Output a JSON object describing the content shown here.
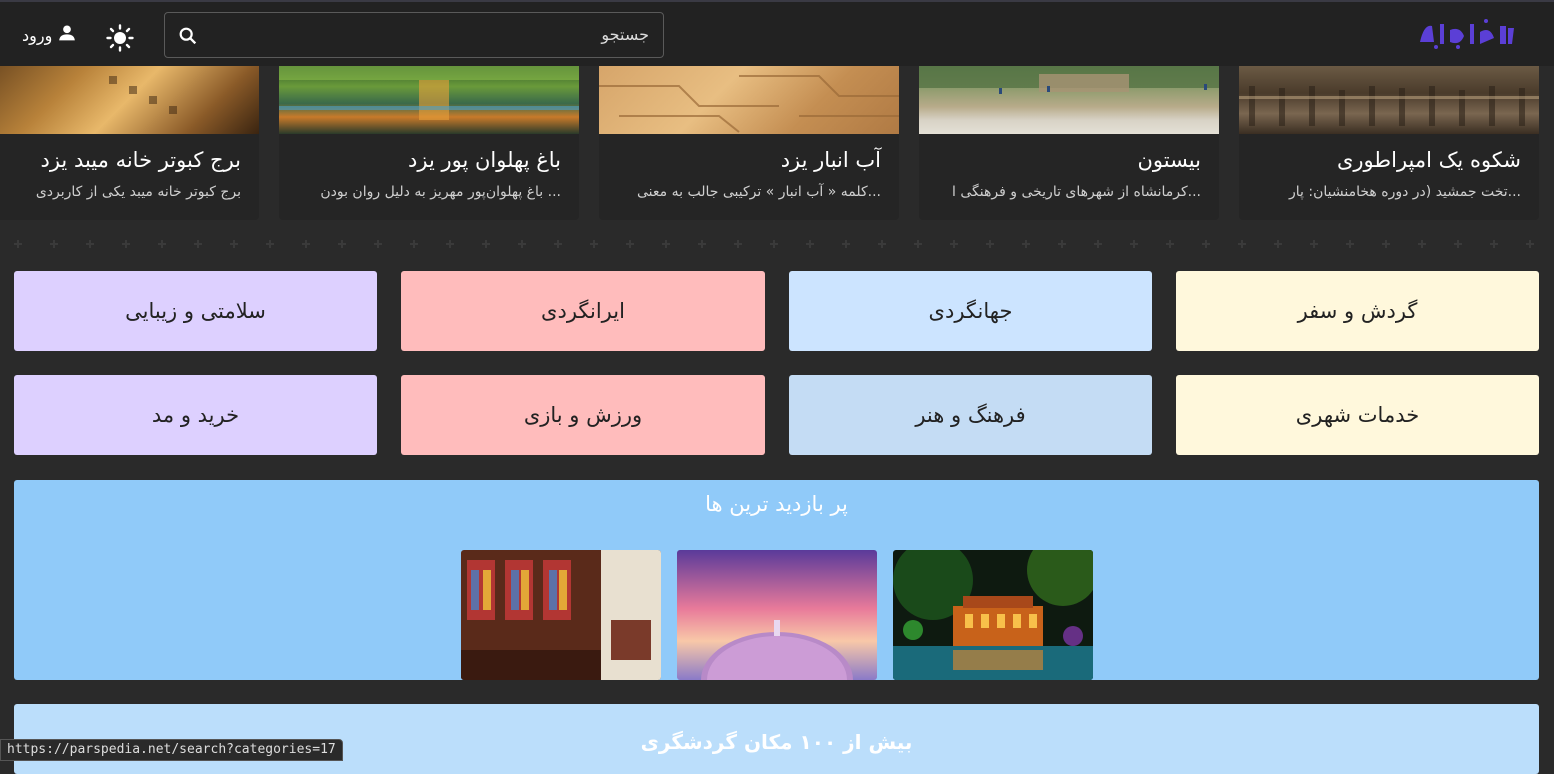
{
  "header": {
    "logo_text": "پارس‌پدیا",
    "search_placeholder": "جستجو",
    "login_label": "ورود",
    "icons": [
      "search-icon",
      "sun-icon",
      "person-icon"
    ]
  },
  "carousel": [
    {
      "title": "شکوه یک امپراطوری",
      "desc": "تخت جمشید (در دوره هخامنشیان: پار..."
    },
    {
      "title": "بیستون",
      "desc": "کرمانشاه از شهرهای تاریخی و فرهنگی ا..."
    },
    {
      "title": "آب انبار یزد",
      "desc": "کلمه « آب انبار » ترکیبی جالب به معنی..."
    },
    {
      "title": "باغ پهلوان پور یزد",
      "desc": "باغ پهلوان‌پور مهریز به دلیل روان بودن ..."
    },
    {
      "title": "برج کبوتر خانه میبد یزد",
      "desc": "برج کبوتر خانه میبد یکی از کاربردی‌"
    }
  ],
  "categories": [
    {
      "label": "گردش و سفر",
      "color": "#fff8dc"
    },
    {
      "label": "جهانگردی",
      "color": "#cce4ff"
    },
    {
      "label": "ایرانگردی",
      "color": "#ffbcbc"
    },
    {
      "label": "سلامتی و زیبایی",
      "color": "#ddd0ff"
    },
    {
      "label": "خدمات شهری",
      "color": "#fff8dc"
    },
    {
      "label": "فرهنگ و هنر",
      "color": "#c4dcf4"
    },
    {
      "label": "ورزش و بازی",
      "color": "#ffbcbc"
    },
    {
      "label": "خرید و مد",
      "color": "#ddd0ff"
    }
  ],
  "popular": {
    "title": "پر بازدید ترین ها"
  },
  "more": {
    "title": "بیش از ۱۰۰ مکان گردشگری"
  },
  "status_url": "https://parspedia.net/search?categories=17",
  "colors": {
    "topbar": "#222222",
    "logo": "#5b3fd6",
    "popular_bg": "#90caf9",
    "more_bg": "#bbdefb"
  }
}
